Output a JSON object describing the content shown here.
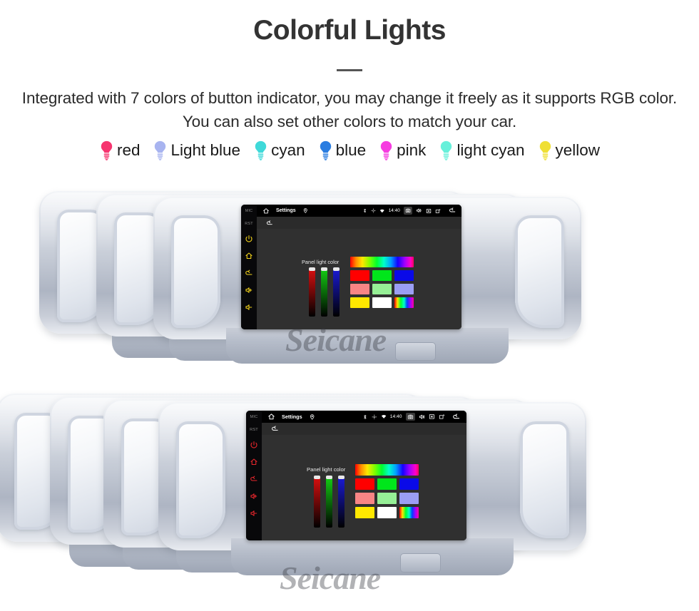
{
  "header": {
    "title": "Colorful Lights",
    "subtitle": "Integrated with 7 colors of button indicator, you may change it freely as it supports RGB color. You can also set other colors to match your car."
  },
  "color_legend": [
    {
      "label": "red",
      "color": "#f6356f",
      "icon": "bulb-icon"
    },
    {
      "label": "Light blue",
      "color": "#a8b4f0",
      "icon": "bulb-icon"
    },
    {
      "label": "cyan",
      "color": "#3fd9d9",
      "icon": "bulb-icon"
    },
    {
      "label": "blue",
      "color": "#2a7de1",
      "icon": "bulb-icon"
    },
    {
      "label": "pink",
      "color": "#f63ce0",
      "icon": "bulb-icon"
    },
    {
      "label": "light cyan",
      "color": "#67f0da",
      "icon": "bulb-icon"
    },
    {
      "label": "yellow",
      "color": "#efdf34",
      "icon": "bulb-icon"
    }
  ],
  "screen": {
    "status_bar": {
      "home_icon": "home-icon",
      "title": "Settings",
      "pin_icon": "location-pin-icon",
      "bluetooth_icon": "bluetooth-icon",
      "gps_icon": "gps-icon",
      "wifi_icon": "wifi-icon",
      "clock": "14:40",
      "screenshot_icon": "camera-icon",
      "volume_icon": "volume-icon",
      "close_icon": "close-box-icon",
      "recents_icon": "recents-icon",
      "back_icon": "back-arrow-icon"
    },
    "action_bar": {
      "back_icon": "back-arrow-icon"
    },
    "panel_label": "Panel light color",
    "sliders": [
      {
        "name": "red-channel",
        "color": "#e01010",
        "value": 96
      },
      {
        "name": "green-channel",
        "color": "#14d414",
        "value": 96
      },
      {
        "name": "blue-channel",
        "color": "#1b1bdc",
        "value": 96
      }
    ],
    "swatches": {
      "rainbow_bar": "rainbow-gradient",
      "rows": [
        [
          "#ff0000",
          "#00e61b",
          "#0a0ae8"
        ],
        [
          "#f88585",
          "#96ef96",
          "#9b9ef4"
        ],
        [
          "#ffe800",
          "#ffffff",
          "vertical-rainbow"
        ]
      ]
    }
  },
  "sidebar_buttons": {
    "mic_label": "MIC",
    "rst_label": "RST",
    "icons": [
      "power-icon",
      "home-icon",
      "back-icon",
      "volume-up-icon",
      "volume-down-icon"
    ]
  },
  "watermark": "Seicane",
  "rows": [
    {
      "name": "top-row",
      "units": [
        {
          "light_color": "#2fdd4f",
          "front": false
        },
        {
          "light_color": "#6f6fe8",
          "front": false
        },
        {
          "light_color": "#f2d21a",
          "front": true
        }
      ]
    },
    {
      "name": "bottom-row",
      "units": [
        {
          "light_color": "#e8262c",
          "front": false
        },
        {
          "light_color": "#2fdd4f",
          "front": false
        },
        {
          "light_color": "#2a5bf0",
          "front": false
        },
        {
          "light_color": "#e8262c",
          "front": true
        }
      ]
    }
  ]
}
